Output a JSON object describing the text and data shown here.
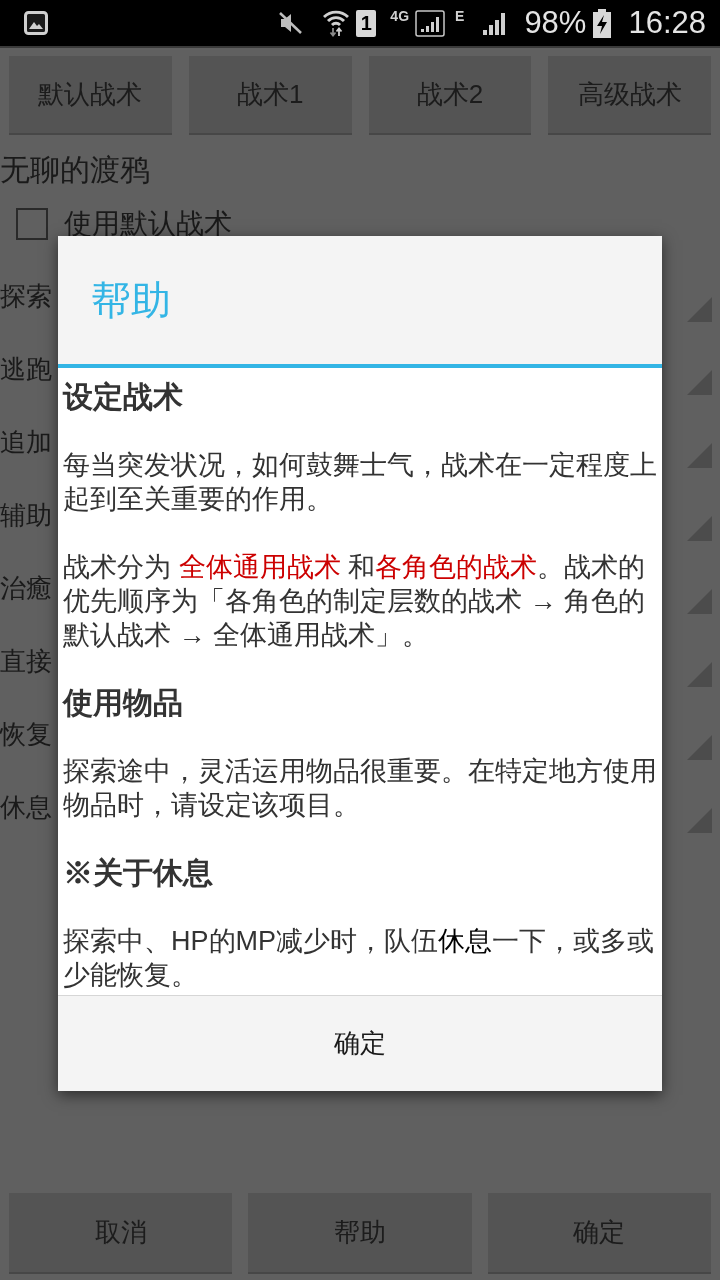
{
  "status_bar": {
    "sim_slot": "1",
    "network_labels": [
      "4G",
      "E"
    ],
    "battery": "98%",
    "time": "16:28"
  },
  "top_buttons": [
    "默认战术",
    "战术1",
    "战术2",
    "高级战术"
  ],
  "character_name": "无聊的渡鸦",
  "use_default_checkbox": {
    "label": "使用默认战术",
    "checked": false
  },
  "setting_rows": [
    "探索",
    "逃跑",
    "追加",
    "辅助",
    "治癒",
    "直接",
    "恢复",
    "休息"
  ],
  "dialog": {
    "title": "帮助",
    "sections": [
      {
        "kind": "heading",
        "text": "设定战术"
      },
      {
        "kind": "paragraph",
        "runs": [
          {
            "text": "每当突发状况，如何鼓舞士气，战术在一定程度上起到至关重要的作用。"
          }
        ]
      },
      {
        "kind": "paragraph",
        "runs": [
          {
            "text": "战术分为 "
          },
          {
            "text": "全体通用战术",
            "color": "#cc0000"
          },
          {
            "text": " 和"
          },
          {
            "text": "各角色的战术",
            "color": "#cc0000"
          },
          {
            "text": "。战术的优先顺序为「各角色的制定层数的战术 → 角色的默认战术 → 全体通用战术」。"
          }
        ]
      },
      {
        "kind": "heading",
        "text": "使用物品"
      },
      {
        "kind": "paragraph",
        "runs": [
          {
            "text": "探索途中，灵活运用物品很重要。在特定地方使用物品时，请设定该项目。"
          }
        ]
      },
      {
        "kind": "heading",
        "text": "※关于休息"
      },
      {
        "kind": "paragraph",
        "runs": [
          {
            "text": "探索中、HP的MP减少时，队伍"
          },
          {
            "text": "休息",
            "color": "#000000"
          },
          {
            "text": "一下，或多或少能恢复。"
          }
        ]
      }
    ],
    "button": "确定"
  },
  "bottom_buttons": [
    "取消",
    "帮助",
    "确定"
  ]
}
